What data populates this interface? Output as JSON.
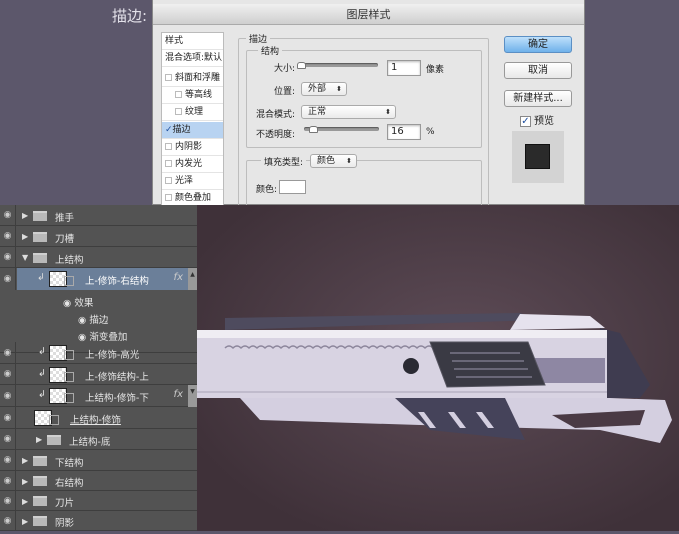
{
  "top_label": "描边:",
  "dialog": {
    "title": "图层样式",
    "style_list": [
      {
        "label": "样式",
        "type": "header"
      },
      {
        "label": "混合选项:默认",
        "type": "header"
      },
      {
        "label": "斜面和浮雕",
        "checked": false
      },
      {
        "label": "等高线",
        "checked": false
      },
      {
        "label": "纹理",
        "checked": false
      },
      {
        "label": "描边",
        "checked": true,
        "selected": true
      },
      {
        "label": "内阴影",
        "checked": false
      },
      {
        "label": "内发光",
        "checked": false
      },
      {
        "label": "光泽",
        "checked": false
      },
      {
        "label": "颜色叠加",
        "checked": false
      }
    ],
    "stroke_group": "描边",
    "structure_group": "结构",
    "size_label": "大小:",
    "size_value": "1",
    "size_unit": "像素",
    "position_label": "位置:",
    "position_value": "外部",
    "blend_label": "混合模式:",
    "blend_value": "正常",
    "opacity_label": "不透明度:",
    "opacity_value": "16",
    "opacity_unit": "%",
    "fill_type_label": "填充类型:",
    "fill_type_value": "颜色",
    "color_label": "颜色:",
    "stroke_color": "#ffffff",
    "ok": "确定",
    "cancel": "取消",
    "new_style": "新建样式...",
    "preview_label": "预览",
    "preview_checked": true
  },
  "layers": [
    {
      "name": "推手",
      "kind": "folder"
    },
    {
      "name": "刀槽",
      "kind": "folder"
    },
    {
      "name": "上结构",
      "kind": "folder-open"
    },
    {
      "name": "上-修饰-右结构",
      "kind": "layer",
      "fx": "fx",
      "selected": true
    },
    {
      "name": "效果",
      "kind": "effects"
    },
    {
      "name": "描边",
      "kind": "effect"
    },
    {
      "name": "渐变叠加",
      "kind": "effect"
    },
    {
      "name": "上-修饰-高光",
      "kind": "layer"
    },
    {
      "name": "上-修饰结构-上",
      "kind": "layer"
    },
    {
      "name": "上结构-修饰-下",
      "kind": "layer",
      "fx": "fx"
    },
    {
      "name": "上结构-修饰",
      "kind": "layer-top"
    },
    {
      "name": "上结构-底",
      "kind": "subfolder"
    },
    {
      "name": "下结构",
      "kind": "folder"
    },
    {
      "name": "右结构",
      "kind": "folder"
    },
    {
      "name": "刀片",
      "kind": "folder"
    },
    {
      "name": "阴影",
      "kind": "folder"
    }
  ],
  "colors": {
    "accent": "#6fb1ea",
    "selected_row": "#6b7f99",
    "canvas": "#4a3c44"
  }
}
